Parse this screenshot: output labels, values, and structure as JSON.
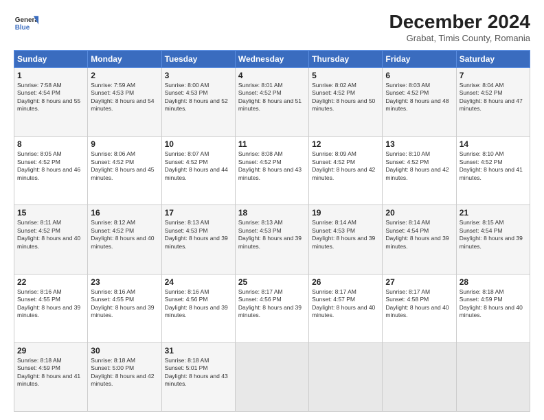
{
  "logo": {
    "line1": "General",
    "line2": "Blue"
  },
  "title": "December 2024",
  "subtitle": "Grabat, Timis County, Romania",
  "days_header": [
    "Sunday",
    "Monday",
    "Tuesday",
    "Wednesday",
    "Thursday",
    "Friday",
    "Saturday"
  ],
  "weeks": [
    [
      {
        "day": "1",
        "sunrise": "7:58 AM",
        "sunset": "4:54 PM",
        "daylight": "8 hours and 55 minutes."
      },
      {
        "day": "2",
        "sunrise": "7:59 AM",
        "sunset": "4:53 PM",
        "daylight": "8 hours and 54 minutes."
      },
      {
        "day": "3",
        "sunrise": "8:00 AM",
        "sunset": "4:53 PM",
        "daylight": "8 hours and 52 minutes."
      },
      {
        "day": "4",
        "sunrise": "8:01 AM",
        "sunset": "4:52 PM",
        "daylight": "8 hours and 51 minutes."
      },
      {
        "day": "5",
        "sunrise": "8:02 AM",
        "sunset": "4:52 PM",
        "daylight": "8 hours and 50 minutes."
      },
      {
        "day": "6",
        "sunrise": "8:03 AM",
        "sunset": "4:52 PM",
        "daylight": "8 hours and 48 minutes."
      },
      {
        "day": "7",
        "sunrise": "8:04 AM",
        "sunset": "4:52 PM",
        "daylight": "8 hours and 47 minutes."
      }
    ],
    [
      {
        "day": "8",
        "sunrise": "8:05 AM",
        "sunset": "4:52 PM",
        "daylight": "8 hours and 46 minutes."
      },
      {
        "day": "9",
        "sunrise": "8:06 AM",
        "sunset": "4:52 PM",
        "daylight": "8 hours and 45 minutes."
      },
      {
        "day": "10",
        "sunrise": "8:07 AM",
        "sunset": "4:52 PM",
        "daylight": "8 hours and 44 minutes."
      },
      {
        "day": "11",
        "sunrise": "8:08 AM",
        "sunset": "4:52 PM",
        "daylight": "8 hours and 43 minutes."
      },
      {
        "day": "12",
        "sunrise": "8:09 AM",
        "sunset": "4:52 PM",
        "daylight": "8 hours and 42 minutes."
      },
      {
        "day": "13",
        "sunrise": "8:10 AM",
        "sunset": "4:52 PM",
        "daylight": "8 hours and 42 minutes."
      },
      {
        "day": "14",
        "sunrise": "8:10 AM",
        "sunset": "4:52 PM",
        "daylight": "8 hours and 41 minutes."
      }
    ],
    [
      {
        "day": "15",
        "sunrise": "8:11 AM",
        "sunset": "4:52 PM",
        "daylight": "8 hours and 40 minutes."
      },
      {
        "day": "16",
        "sunrise": "8:12 AM",
        "sunset": "4:52 PM",
        "daylight": "8 hours and 40 minutes."
      },
      {
        "day": "17",
        "sunrise": "8:13 AM",
        "sunset": "4:53 PM",
        "daylight": "8 hours and 39 minutes."
      },
      {
        "day": "18",
        "sunrise": "8:13 AM",
        "sunset": "4:53 PM",
        "daylight": "8 hours and 39 minutes."
      },
      {
        "day": "19",
        "sunrise": "8:14 AM",
        "sunset": "4:53 PM",
        "daylight": "8 hours and 39 minutes."
      },
      {
        "day": "20",
        "sunrise": "8:14 AM",
        "sunset": "4:54 PM",
        "daylight": "8 hours and 39 minutes."
      },
      {
        "day": "21",
        "sunrise": "8:15 AM",
        "sunset": "4:54 PM",
        "daylight": "8 hours and 39 minutes."
      }
    ],
    [
      {
        "day": "22",
        "sunrise": "8:16 AM",
        "sunset": "4:55 PM",
        "daylight": "8 hours and 39 minutes."
      },
      {
        "day": "23",
        "sunrise": "8:16 AM",
        "sunset": "4:55 PM",
        "daylight": "8 hours and 39 minutes."
      },
      {
        "day": "24",
        "sunrise": "8:16 AM",
        "sunset": "4:56 PM",
        "daylight": "8 hours and 39 minutes."
      },
      {
        "day": "25",
        "sunrise": "8:17 AM",
        "sunset": "4:56 PM",
        "daylight": "8 hours and 39 minutes."
      },
      {
        "day": "26",
        "sunrise": "8:17 AM",
        "sunset": "4:57 PM",
        "daylight": "8 hours and 40 minutes."
      },
      {
        "day": "27",
        "sunrise": "8:17 AM",
        "sunset": "4:58 PM",
        "daylight": "8 hours and 40 minutes."
      },
      {
        "day": "28",
        "sunrise": "8:18 AM",
        "sunset": "4:59 PM",
        "daylight": "8 hours and 40 minutes."
      }
    ],
    [
      {
        "day": "29",
        "sunrise": "8:18 AM",
        "sunset": "4:59 PM",
        "daylight": "8 hours and 41 minutes."
      },
      {
        "day": "30",
        "sunrise": "8:18 AM",
        "sunset": "5:00 PM",
        "daylight": "8 hours and 42 minutes."
      },
      {
        "day": "31",
        "sunrise": "8:18 AM",
        "sunset": "5:01 PM",
        "daylight": "8 hours and 43 minutes."
      },
      null,
      null,
      null,
      null
    ]
  ]
}
